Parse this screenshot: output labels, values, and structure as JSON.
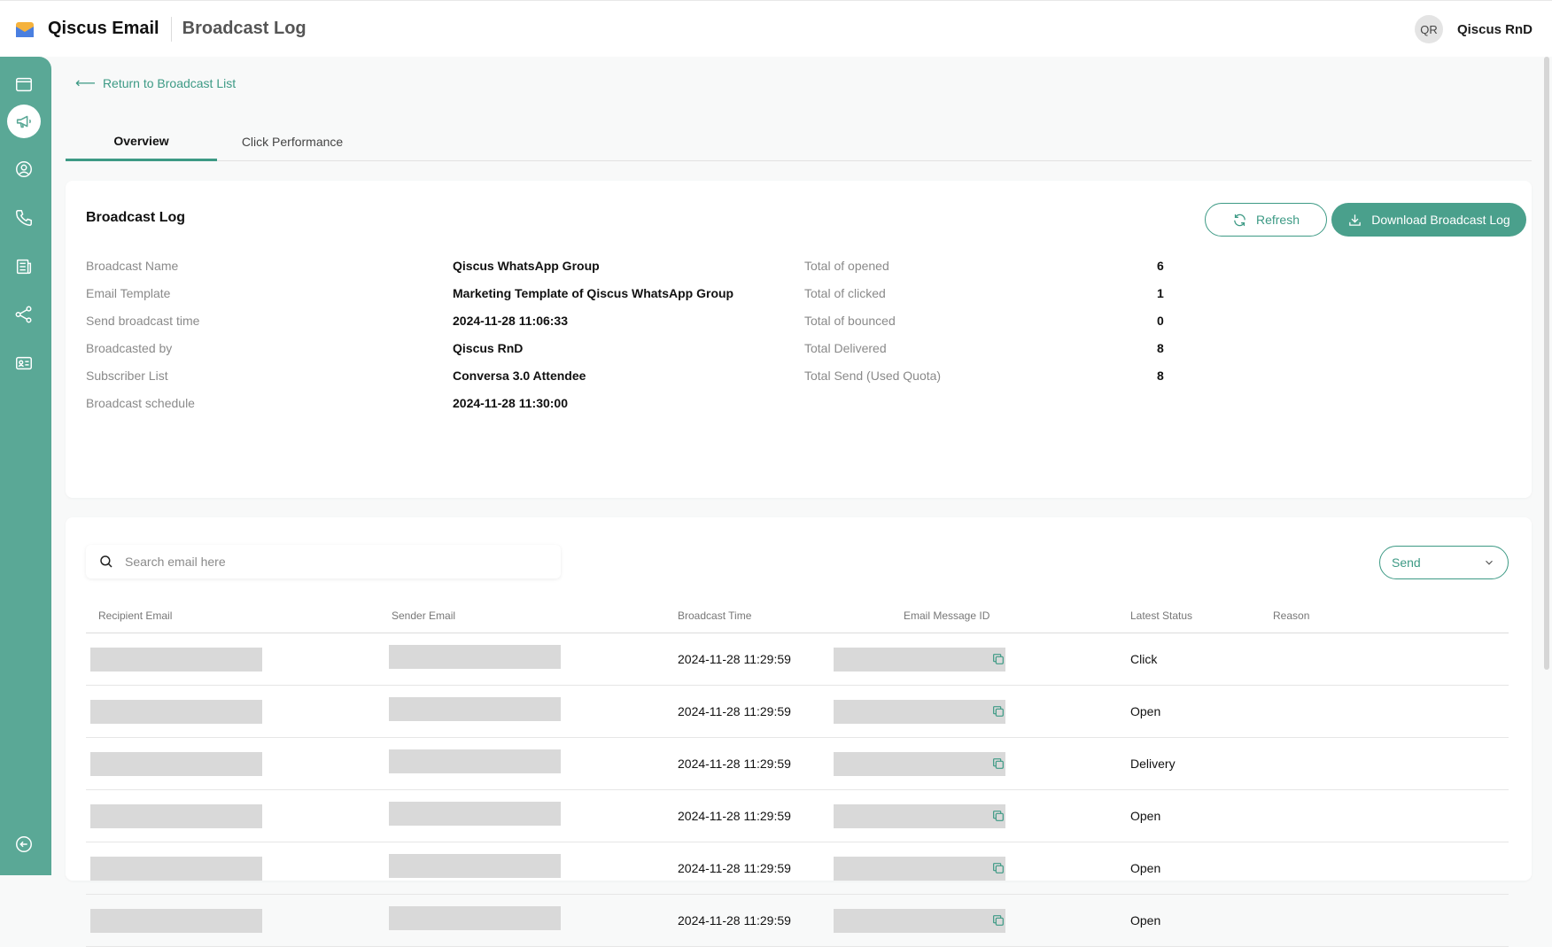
{
  "header": {
    "app_name": "Qiscus Email",
    "page_title": "Broadcast Log",
    "user_initials": "QR",
    "user_name": "Qiscus RnD"
  },
  "sidebar": {
    "items": [
      {
        "icon": "calendar-icon",
        "active": false
      },
      {
        "icon": "megaphone-icon",
        "active": true
      },
      {
        "icon": "user-circle-icon",
        "active": false
      },
      {
        "icon": "phone-icon",
        "active": false
      },
      {
        "icon": "newspaper-icon",
        "active": false
      },
      {
        "icon": "share-nodes-icon",
        "active": false
      },
      {
        "icon": "id-card-icon",
        "active": false
      }
    ],
    "bottom_icon": "collapse-icon"
  },
  "nav": {
    "back_link": "Return to Broadcast List"
  },
  "tabs": [
    "Overview",
    "Click Performance"
  ],
  "broadcast_log": {
    "title": "Broadcast Log",
    "refresh_label": "Refresh",
    "download_label": "Download Broadcast Log",
    "details": [
      {
        "label": "Broadcast Name",
        "value": "Qiscus WhatsApp Group"
      },
      {
        "label": "Email Template",
        "value": "Marketing Template of Qiscus WhatsApp Group"
      },
      {
        "label": "Send broadcast time",
        "value": "2024-11-28 11:06:33"
      },
      {
        "label": "Broadcasted by",
        "value": "Qiscus RnD"
      },
      {
        "label": "Subscriber List",
        "value": "Conversa 3.0 Attendee"
      },
      {
        "label": "Broadcast schedule",
        "value": "2024-11-28 11:30:00"
      }
    ],
    "stats": [
      {
        "label": "Total of opened",
        "value": "6"
      },
      {
        "label": "Total of clicked",
        "value": "1"
      },
      {
        "label": "Total of bounced",
        "value": "0"
      },
      {
        "label": "Total Delivered",
        "value": "8"
      },
      {
        "label": "Total Send (Used Quota)",
        "value": "8"
      }
    ]
  },
  "table": {
    "search_placeholder": "Search email here",
    "filter_value": "Send",
    "columns": [
      "Recipient Email",
      "Sender Email",
      "Broadcast Time",
      "Email Message ID",
      "Latest Status",
      "Reason"
    ],
    "rows": [
      {
        "broadcast_time": "2024-11-28 11:29:59",
        "status": "Click"
      },
      {
        "broadcast_time": "2024-11-28 11:29:59",
        "status": "Open"
      },
      {
        "broadcast_time": "2024-11-28 11:29:59",
        "status": "Delivery"
      },
      {
        "broadcast_time": "2024-11-28 11:29:59",
        "status": "Open"
      },
      {
        "broadcast_time": "2024-11-28 11:29:59",
        "status": "Open"
      },
      {
        "broadcast_time": "2024-11-28 11:29:59",
        "status": "Open"
      }
    ]
  },
  "colors": {
    "accent": "#3d9a85",
    "sidebar": "#5aa896",
    "primary_button": "#4aa08c"
  }
}
